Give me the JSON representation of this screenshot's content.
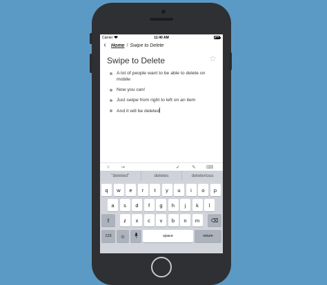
{
  "status_bar": {
    "carrier": "Carrier",
    "time": "11:40 AM"
  },
  "nav": {
    "home_link": "Home",
    "separator": "/",
    "current": "Swipe to Delete"
  },
  "page": {
    "title": "Swipe to Delete",
    "bullets": [
      "A lot of people want to be able to delete on mobile",
      "Now you can!",
      "Just swipe from right to left on an item",
      "And it will be deleted"
    ]
  },
  "suggestions": [
    "\"deleted\"",
    "deletes",
    "deleterious"
  ],
  "keyboard": {
    "row1": [
      "q",
      "w",
      "e",
      "r",
      "t",
      "y",
      "u",
      "i",
      "o",
      "p"
    ],
    "row2": [
      "a",
      "s",
      "d",
      "f",
      "g",
      "h",
      "j",
      "k",
      "l"
    ],
    "row3": [
      "z",
      "x",
      "c",
      "v",
      "b",
      "n",
      "m"
    ],
    "numbers_key": "123",
    "space_key": "space",
    "return_key": "return"
  },
  "colors": {
    "background": "#5b9ac4",
    "caret": "#2a7bd8"
  }
}
